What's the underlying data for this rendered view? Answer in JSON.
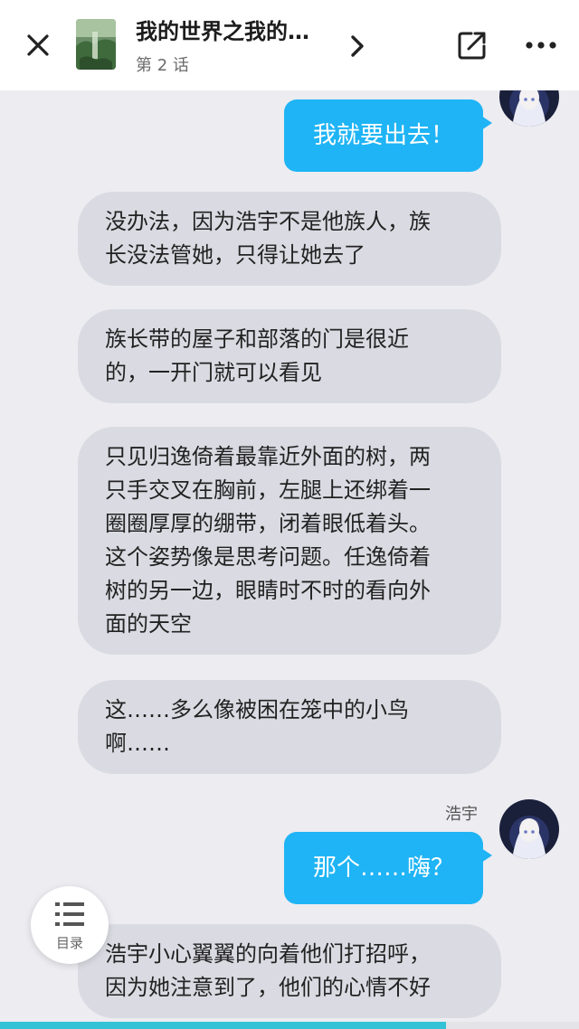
{
  "header": {
    "title": "我的世界之我的…",
    "subtitle": "第 2 话",
    "close_icon": "close-icon",
    "chevron_icon": "chevron-right-icon",
    "share_icon": "share-icon",
    "more_icon": "more-icon"
  },
  "messages": [
    {
      "type": "user",
      "text": "我就要出去！"
    },
    {
      "type": "narration",
      "lines": [
        "没办法，因为浩宇不是他族人，族",
        "长没法管她，只得让她去了"
      ]
    },
    {
      "type": "narration",
      "lines": [
        "族长带的屋子和部落的门是很近",
        "的，一开门就可以看见"
      ]
    },
    {
      "type": "narration",
      "lines": [
        "只见归逸倚着最靠近外面的树，两",
        "只手交叉在胸前，左腿上还绑着一",
        "圈圈厚厚的绷带，闭着眼低着头。",
        "这个姿势像是思考问题。任逸倚着",
        "树的另一边，眼睛时不时的看向外",
        "面的天空"
      ]
    },
    {
      "type": "narration",
      "lines": [
        "这……多么像被困在笼中的小鸟",
        "啊……"
      ]
    },
    {
      "type": "user",
      "speaker": "浩宇",
      "text": "那个……嗨？"
    },
    {
      "type": "narration",
      "lines": [
        "浩宇小心翼翼的向着他们打招呼，",
        "因为她注意到了，他们的心情不好"
      ]
    }
  ],
  "catalog": {
    "label": "目录",
    "icon": "list-icon"
  },
  "progress": {
    "fraction": 0.77
  },
  "colors": {
    "background": "#ececf1",
    "user_bubble": "#1fb4f5",
    "narration_bubble": "#dadbe2",
    "progress": "#34c3d6"
  }
}
